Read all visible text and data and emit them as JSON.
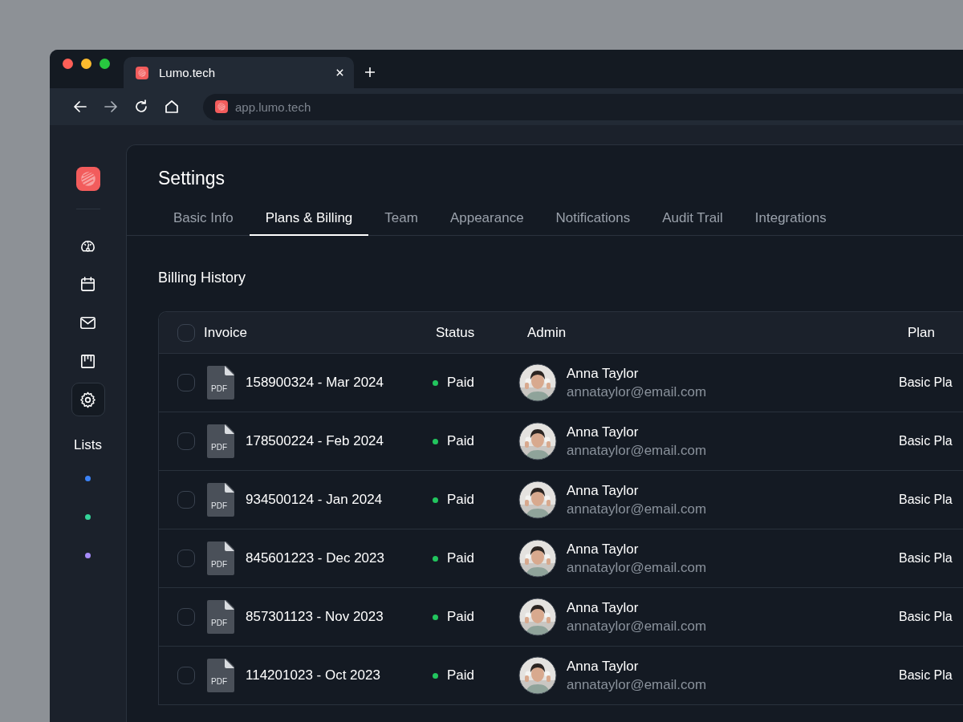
{
  "browser": {
    "tab_title": "Lumo.tech",
    "url": "app.lumo.tech"
  },
  "sidebar": {
    "nav": [
      {
        "kind": "dashboard",
        "selected": false
      },
      {
        "kind": "calendar",
        "selected": false
      },
      {
        "kind": "mail",
        "selected": false
      },
      {
        "kind": "board",
        "selected": false
      },
      {
        "kind": "settings",
        "selected": true
      }
    ],
    "lists_label": "Lists",
    "lists": [
      {
        "color": "#3b82f6"
      },
      {
        "color": "#34d399"
      },
      {
        "color": "#a78bfa"
      }
    ]
  },
  "page": {
    "title": "Settings",
    "tabs": [
      {
        "label": "Basic Info",
        "selected": false
      },
      {
        "label": "Plans & Billing",
        "selected": true
      },
      {
        "label": "Team",
        "selected": false
      },
      {
        "label": "Appearance",
        "selected": false
      },
      {
        "label": "Notifications",
        "selected": false
      },
      {
        "label": "Audit Trail",
        "selected": false
      },
      {
        "label": "Integrations",
        "selected": false
      }
    ],
    "section_title": "Billing History",
    "table": {
      "select_all_checked": false,
      "columns": [
        "Invoice",
        "Status",
        "Admin",
        "Plan"
      ],
      "rows": [
        {
          "checked": false,
          "file_type": "PDF",
          "invoice": "158900324 - Mar 2024",
          "status": "Paid",
          "admin_name": "Anna Taylor",
          "admin_email": "annataylor@email.com",
          "plan": "Basic Pla"
        },
        {
          "checked": false,
          "file_type": "PDF",
          "invoice": "178500224 - Feb 2024",
          "status": "Paid",
          "admin_name": "Anna Taylor",
          "admin_email": "annataylor@email.com",
          "plan": "Basic Pla"
        },
        {
          "checked": false,
          "file_type": "PDF",
          "invoice": "934500124 - Jan 2024",
          "status": "Paid",
          "admin_name": "Anna Taylor",
          "admin_email": "annataylor@email.com",
          "plan": "Basic Pla"
        },
        {
          "checked": false,
          "file_type": "PDF",
          "invoice": "845601223 - Dec 2023",
          "status": "Paid",
          "admin_name": "Anna Taylor",
          "admin_email": "annataylor@email.com",
          "plan": "Basic Pla"
        },
        {
          "checked": false,
          "file_type": "PDF",
          "invoice": "857301123 - Nov 2023",
          "status": "Paid",
          "admin_name": "Anna Taylor",
          "admin_email": "annataylor@email.com",
          "plan": "Basic Pla"
        },
        {
          "checked": false,
          "file_type": "PDF",
          "invoice": "114201023 - Oct 2023",
          "status": "Paid",
          "admin_name": "Anna Taylor",
          "admin_email": "annataylor@email.com",
          "plan": "Basic Pla"
        }
      ]
    }
  }
}
